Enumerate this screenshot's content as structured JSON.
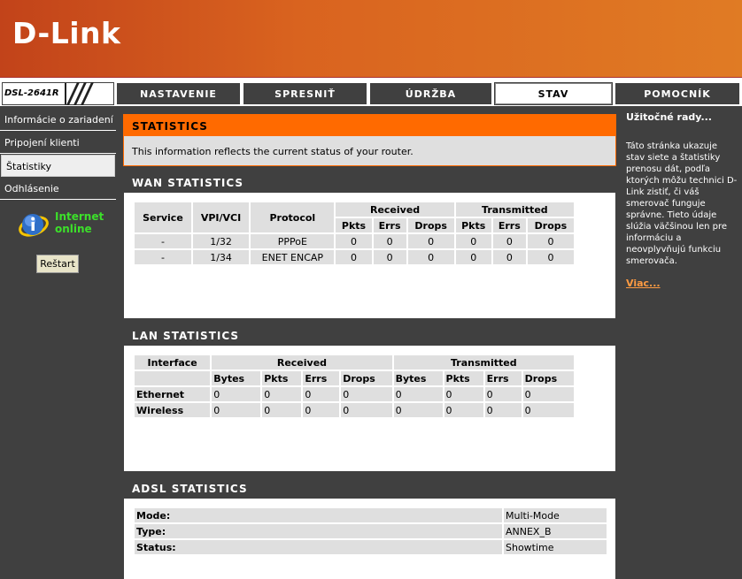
{
  "brand": "D-Link",
  "model": "DSL-2641R",
  "nav_tabs": [
    "NASTAVENIE",
    "SPRESNIŤ",
    "ÚDRŽBA",
    "STAV",
    "POMOCNÍK"
  ],
  "active_tab": "STAV",
  "sidebar": {
    "items": [
      "Informácie o zariadení",
      "Pripojení klienti",
      "Štatistiky",
      "Odhlásenie"
    ],
    "active": "Štatistiky",
    "internet_status": [
      "Internet",
      "online"
    ],
    "restart_label": "Reštart"
  },
  "statistics": {
    "title": "STATISTICS",
    "description": "This information reflects the current status of your router."
  },
  "wan": {
    "title": "WAN STATISTICS",
    "headers": [
      "Service",
      "VPI/VCI",
      "Protocol",
      "Received",
      "Transmitted"
    ],
    "sub_headers": [
      "Pkts",
      "Errs",
      "Drops",
      "Pkts",
      "Errs",
      "Drops"
    ],
    "rows": [
      [
        "-",
        "1/32",
        "PPPoE",
        "0",
        "0",
        "0",
        "0",
        "0",
        "0"
      ],
      [
        "-",
        "1/34",
        "ENET ENCAP",
        "0",
        "0",
        "0",
        "0",
        "0",
        "0"
      ]
    ]
  },
  "lan": {
    "title": "LAN STATISTICS",
    "headers": [
      "Interface",
      "Received",
      "Transmitted"
    ],
    "sub_headers": [
      "Bytes",
      "Pkts",
      "Errs",
      "Drops",
      "Bytes",
      "Pkts",
      "Errs",
      "Drops"
    ],
    "rows": [
      [
        "Ethernet",
        "0",
        "0",
        "0",
        "0",
        "0",
        "0",
        "0",
        "0"
      ],
      [
        "Wireless",
        "0",
        "0",
        "0",
        "0",
        "0",
        "0",
        "0",
        "0"
      ]
    ]
  },
  "adsl": {
    "title": "ADSL STATISTICS",
    "rows": [
      [
        "Mode:",
        "Multi-Mode"
      ],
      [
        "Type:",
        "ANNEX_B"
      ],
      [
        "Status:",
        "Showtime"
      ]
    ]
  },
  "hints": {
    "title": "Užitočné rady...",
    "body": "Táto stránka ukazuje stav siete a štatistiky prenosu dát, podľa ktorých môžu technici D-Link zistiť, či váš smerovač funguje správne. Tieto údaje slúžia väčšinou len pre informáciu a neovplyvňujú funkciu smerovača.",
    "more": "Viac..."
  },
  "colors": {
    "accent": "#ff6a00",
    "dark": "#404040",
    "online": "#3ce02a"
  }
}
